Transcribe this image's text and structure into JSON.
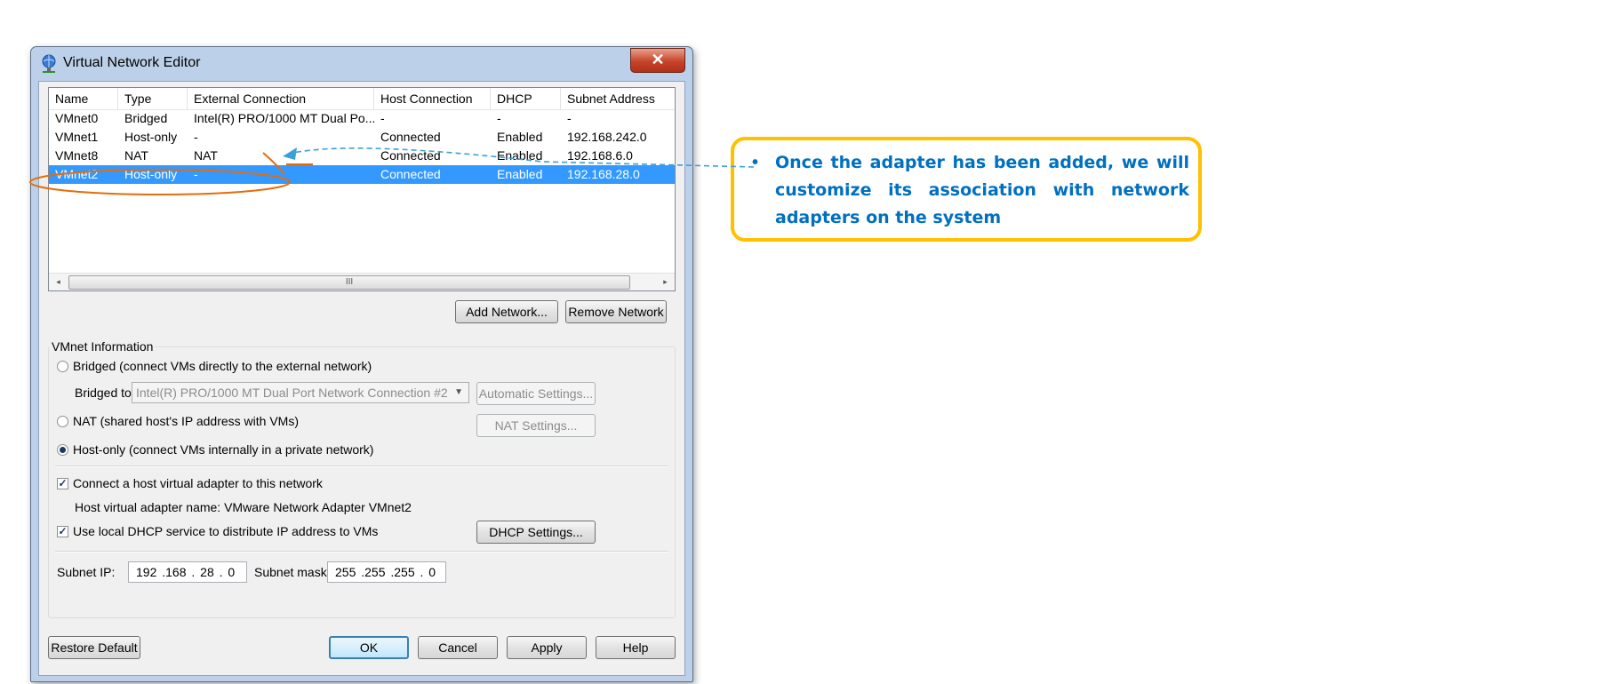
{
  "window": {
    "title": "Virtual Network Editor",
    "close_glyph": "✕"
  },
  "networks": {
    "columns": [
      "Name",
      "Type",
      "External Connection",
      "Host Connection",
      "DHCP",
      "Subnet Address"
    ],
    "rows": [
      [
        "VMnet0",
        "Bridged",
        "Intel(R) PRO/1000 MT Dual Po...",
        "-",
        "-",
        "-"
      ],
      [
        "VMnet1",
        "Host-only",
        "-",
        "Connected",
        "Enabled",
        "192.168.242.0"
      ],
      [
        "VMnet8",
        "NAT",
        "NAT",
        "Connected",
        "Enabled",
        "192.168.6.0"
      ],
      [
        "VMnet2",
        "Host-only",
        "-",
        "Connected",
        "Enabled",
        "192.168.28.0"
      ]
    ],
    "selected_row": 3,
    "scroll_left": "◂",
    "scroll_right": "▸",
    "scroll_grip": "III"
  },
  "buttons": {
    "add_network": "Add Network...",
    "remove_network": "Remove Network",
    "automatic_settings": "Automatic Settings...",
    "nat_settings": "NAT Settings...",
    "dhcp_settings": "DHCP Settings...",
    "restore_default": "Restore Default",
    "ok": "OK",
    "cancel": "Cancel",
    "apply": "Apply",
    "help": "Help"
  },
  "vmnet_info": {
    "group_label": "VMnet Information",
    "bridged_label": "Bridged (connect VMs directly to the external network)",
    "bridged_to_label": "Bridged to:",
    "bridged_to_value": "Intel(R) PRO/1000 MT Dual Port Network Connection #2",
    "nat_label": "NAT (shared host's IP address with VMs)",
    "hostonly_label": "Host-only (connect VMs internally in a private network)",
    "selected_mode": "host-only",
    "connect_adapter_label": "Connect a host virtual adapter to this network",
    "connect_adapter_checked": true,
    "adapter_name_text": "Host virtual adapter name: VMware Network Adapter VMnet2",
    "dhcp_label": "Use local DHCP service to distribute IP address to VMs",
    "dhcp_checked": true,
    "subnet_ip_label": "Subnet IP:",
    "subnet_ip_value": "192 .168 . 28 .  0",
    "subnet_mask_label": "Subnet mask:",
    "subnet_mask_value": "255 .255 .255 .  0",
    "check_glyph": "✓"
  },
  "annotation": {
    "bullet": "•",
    "text": "Once the adapter has been added, we will customize its association with network adapters on the system",
    "border_color": "#ffc000",
    "text_color": "#0070c0",
    "highlight_color": "#e46c0a"
  }
}
